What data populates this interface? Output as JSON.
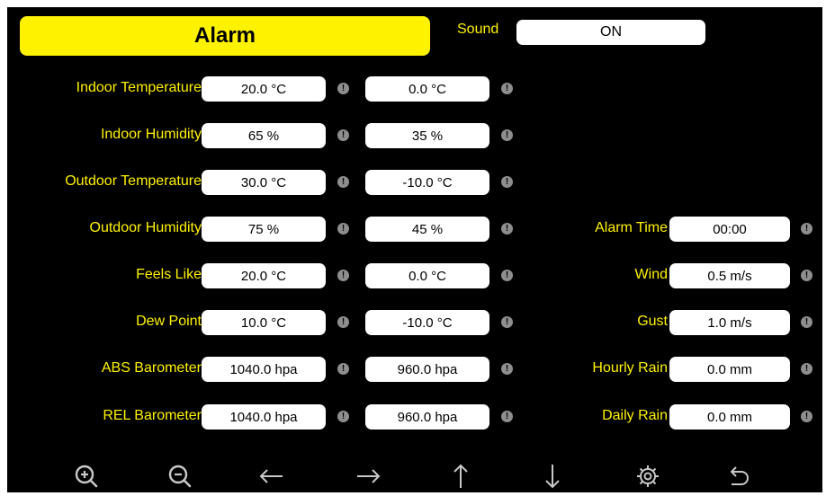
{
  "header": {
    "title": "Alarm",
    "sound_label": "Sound",
    "sound_value": "ON"
  },
  "left_rows": [
    {
      "label": "Indoor Temperature",
      "high": "20.0 °C",
      "low": "0.0 °C"
    },
    {
      "label": "Indoor Humidity",
      "high": "65 %",
      "low": "35 %"
    },
    {
      "label": "Outdoor Temperature",
      "high": "30.0 °C",
      "low": "-10.0 °C"
    },
    {
      "label": "Outdoor Humidity",
      "high": "75 %",
      "low": "45 %"
    },
    {
      "label": "Feels Like",
      "high": "20.0 °C",
      "low": "0.0 °C"
    },
    {
      "label": "Dew Point",
      "high": "10.0 °C",
      "low": "-10.0 °C"
    },
    {
      "label": "ABS Barometer",
      "high": "1040.0 hpa",
      "low": "960.0 hpa"
    },
    {
      "label": "REL Barometer",
      "high": "1040.0 hpa",
      "low": "960.0 hpa"
    }
  ],
  "right_rows": [
    {
      "label": "Alarm Time",
      "value": "00:00"
    },
    {
      "label": "Wind",
      "value": "0.5 m/s"
    },
    {
      "label": "Gust",
      "value": "1.0 m/s"
    },
    {
      "label": "Hourly Rain",
      "value": "0.0 mm"
    },
    {
      "label": "Daily Rain",
      "value": "0.0 mm"
    }
  ],
  "enable_dot_glyph": "!",
  "toolbar": {
    "icons": [
      "zoom-in-icon",
      "zoom-out-icon",
      "arrow-left-icon",
      "arrow-right-icon",
      "arrow-up-icon",
      "arrow-down-icon",
      "gear-icon",
      "return-icon"
    ]
  },
  "colors": {
    "background": "#000000",
    "accent": "#fff200",
    "field": "#ffffff",
    "indicator": "#8e8e8e",
    "icon": "#c8c8c8"
  }
}
